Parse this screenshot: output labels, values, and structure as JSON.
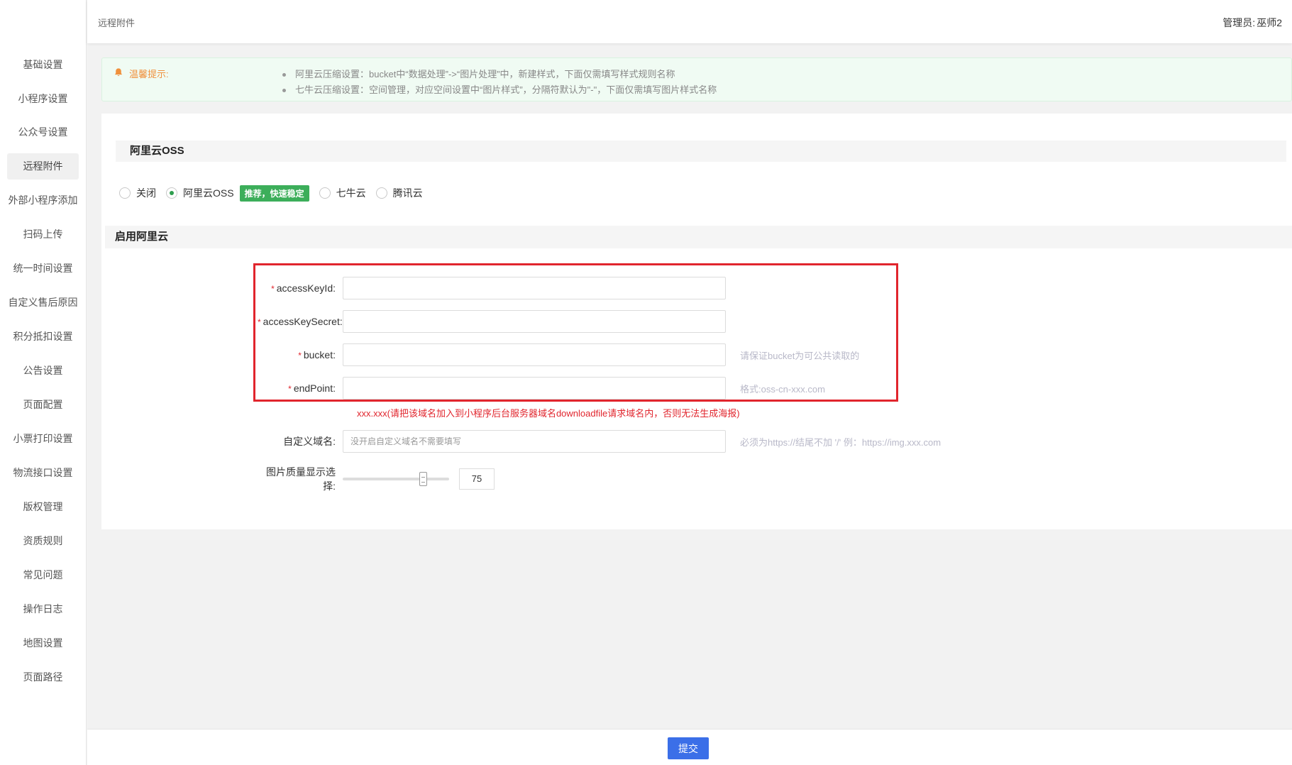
{
  "sidebar": {
    "items": [
      {
        "label": "基础设置"
      },
      {
        "label": "小程序设置"
      },
      {
        "label": "公众号设置"
      },
      {
        "label": "远程附件"
      },
      {
        "label": "外部小程序添加"
      },
      {
        "label": "扫码上传"
      },
      {
        "label": "统一时间设置"
      },
      {
        "label": "自定义售后原因"
      },
      {
        "label": "积分抵扣设置"
      },
      {
        "label": "公告设置"
      },
      {
        "label": "页面配置"
      },
      {
        "label": "小票打印设置"
      },
      {
        "label": "物流接口设置"
      },
      {
        "label": "版权管理"
      },
      {
        "label": "资质规则"
      },
      {
        "label": "常见问题"
      },
      {
        "label": "操作日志"
      },
      {
        "label": "地图设置"
      },
      {
        "label": "页面路径"
      }
    ],
    "active_index": 3
  },
  "header": {
    "breadcrumb": "远程附件",
    "admin_label": "管理员:",
    "admin_name": "巫师2"
  },
  "notice": {
    "label": "温馨提示:",
    "items": [
      "阿里云压缩设置：bucket中“数据处理”->“图片处理”中，新建样式，下面仅需填写样式规则名称",
      "七牛云压缩设置：空间管理，对应空间设置中“图片样式”，分隔符默认为\"-\"，下面仅需填写图片样式名称"
    ]
  },
  "storage": {
    "section_title": "阿里云OSS",
    "options": [
      {
        "label": "关闭",
        "checked": false
      },
      {
        "label": "阿里云OSS",
        "checked": true
      },
      {
        "label": "七牛云",
        "checked": false
      },
      {
        "label": "腾讯云",
        "checked": false
      }
    ],
    "recommend_badge": "推荐，快速稳定"
  },
  "aliyun": {
    "section_title": "启用阿里云",
    "required_mark": "*",
    "fields": {
      "access_key_id": {
        "label": "accessKeyId:",
        "value": "",
        "placeholder": ""
      },
      "access_key_secret": {
        "label": "accessKeySecret:",
        "value": "",
        "placeholder": ""
      },
      "bucket": {
        "label": "bucket:",
        "value": "",
        "placeholder": "",
        "hint": "请保证bucket为可公共读取的"
      },
      "endpoint": {
        "label": "endPoint:",
        "value": "",
        "placeholder": "",
        "hint": "格式:oss-cn-xxx.com"
      }
    },
    "warning": "xxx.xxx(请把该域名加入到小程序后台服务器域名downloadfile请求域名内，否则无法生成海报)",
    "custom_domain": {
      "label": "自定义域名:",
      "placeholder": "没开启自定义域名不需要填写",
      "hint": "必须为https://结尾不加  '/' 例：https://img.xxx.com"
    },
    "quality": {
      "label": "图片质量显示选择:",
      "value": 75,
      "value_text": "75",
      "min": 0,
      "max": 100
    }
  },
  "footer": {
    "submit_label": "提交"
  },
  "colors": {
    "accent": "#3b6fe8",
    "badge_green": "#3cae5a",
    "highlight_red": "#e1252d",
    "notice_orange": "#f0903c"
  }
}
